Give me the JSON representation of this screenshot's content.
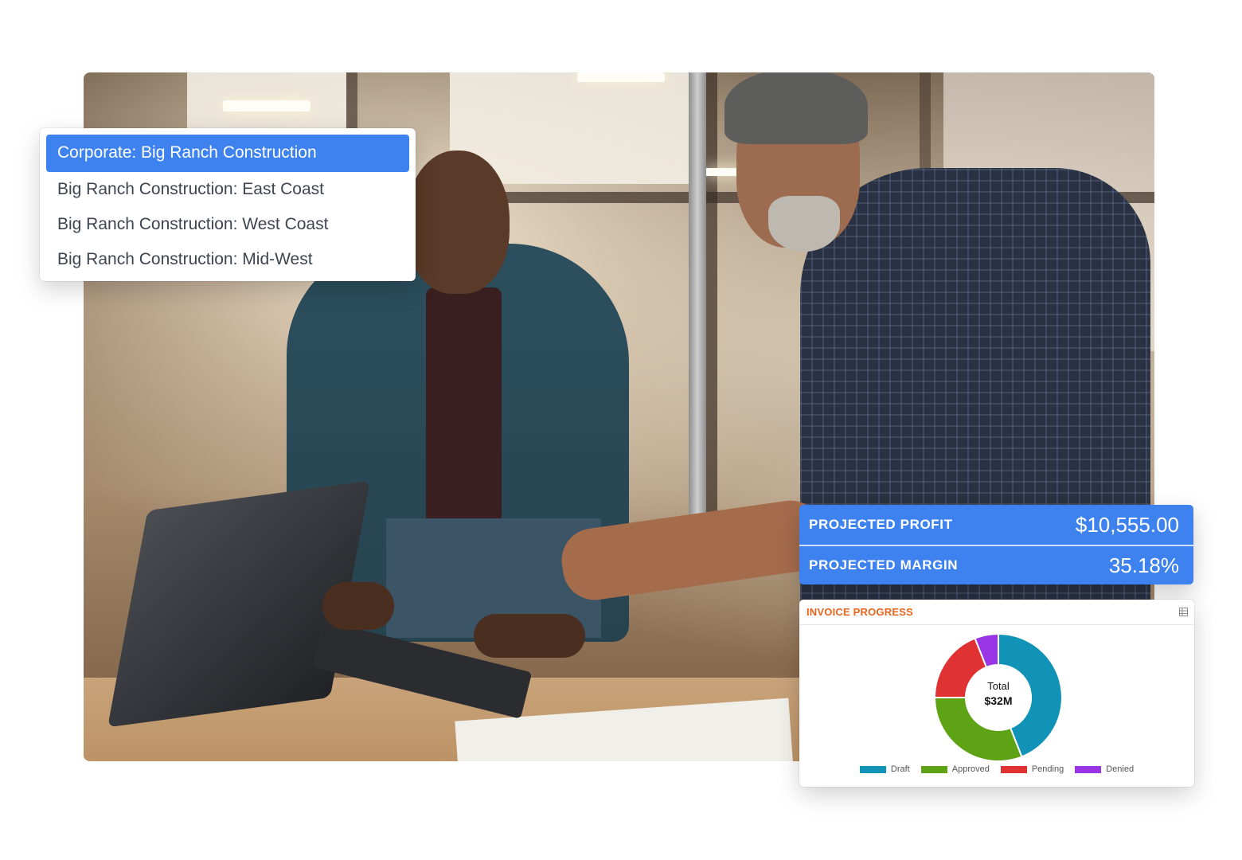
{
  "dropdown": {
    "items": [
      {
        "label": "Corporate: Big Ranch Construction",
        "selected": true
      },
      {
        "label": "Big Ranch Construction: East Coast",
        "selected": false
      },
      {
        "label": "Big Ranch Construction: West Coast",
        "selected": false
      },
      {
        "label": "Big Ranch Construction: Mid-West",
        "selected": false
      }
    ],
    "selected_color": "#3e82f0"
  },
  "metrics": {
    "profit_label": "PROJECTED PROFIT",
    "profit_value": "$10,555.00",
    "margin_label": "PROJECTED MARGIN",
    "margin_value": "35.18%",
    "background_color": "#3e82f0"
  },
  "invoice": {
    "title": "INVOICE PROGRESS",
    "title_color": "#e8641c",
    "icon": "grid-icon",
    "center_label": "Total",
    "center_value": "$32M",
    "chart_data": {
      "type": "pie",
      "title": "INVOICE PROGRESS",
      "categories": [
        "Draft",
        "Approved",
        "Pending",
        "Denied"
      ],
      "values": [
        44,
        31,
        19,
        6
      ],
      "colors": [
        "#1193b8",
        "#5ea316",
        "#e03232",
        "#9935e5"
      ],
      "donut": true,
      "legend": "bottom"
    }
  }
}
